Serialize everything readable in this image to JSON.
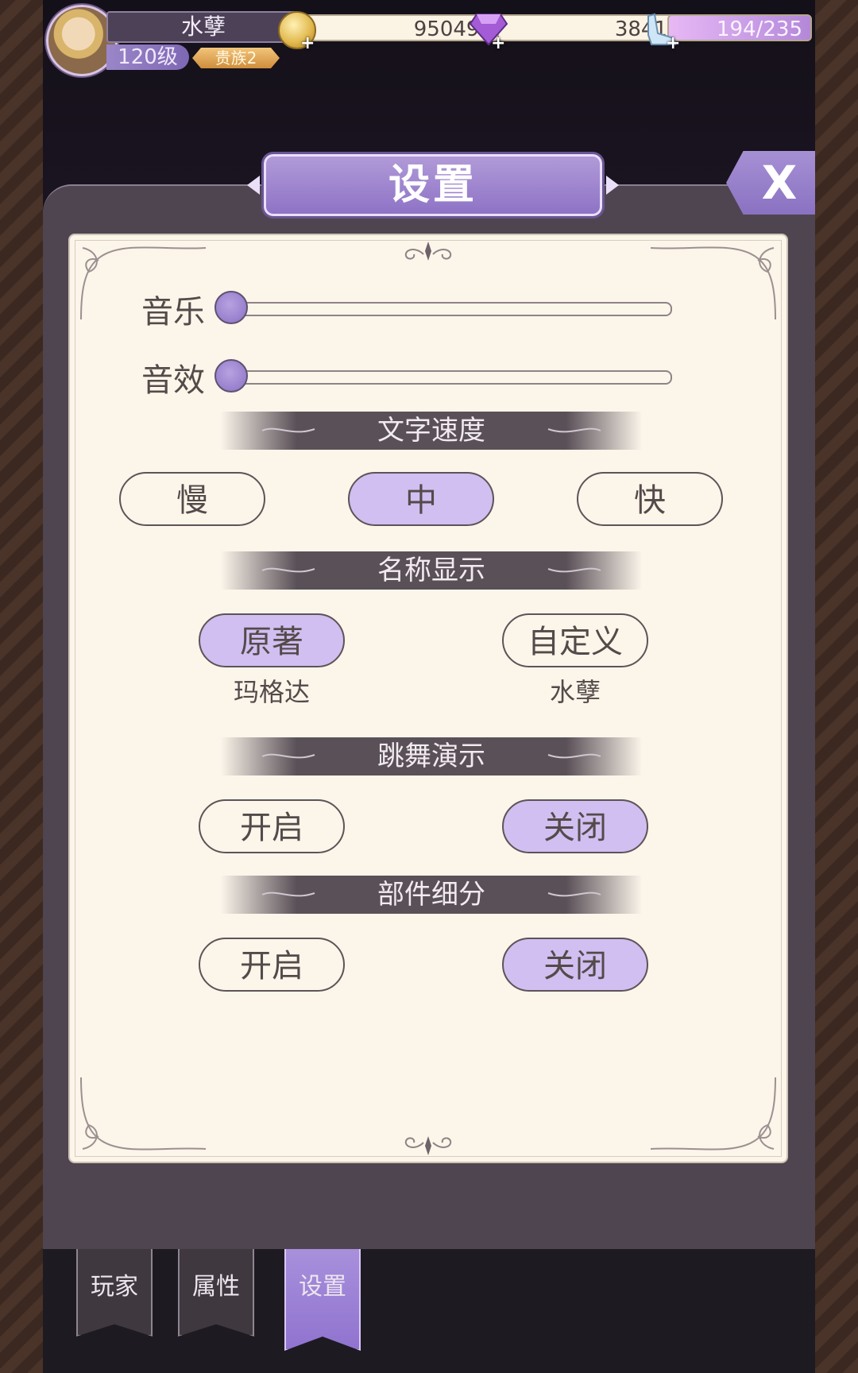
{
  "player": {
    "name": "水孽",
    "level": "120级",
    "noble": "贵族2"
  },
  "resources": {
    "gold": "950493",
    "diamonds": "3841",
    "energy": "194/235"
  },
  "title": "设置",
  "close_label": "X",
  "audio": {
    "music_label": "音乐",
    "music_level": 0,
    "sfx_label": "音效",
    "sfx_level": 0
  },
  "text_speed": {
    "header": "文字速度",
    "options": [
      "慢",
      "中",
      "快"
    ],
    "selected": "中"
  },
  "name_display": {
    "header": "名称显示",
    "options": [
      {
        "label": "原著",
        "sub": "玛格达"
      },
      {
        "label": "自定义",
        "sub": "水孽"
      }
    ],
    "selected": "原著"
  },
  "dance_demo": {
    "header": "跳舞演示",
    "on_label": "开启",
    "off_label": "关闭",
    "selected": "关闭"
  },
  "part_detail": {
    "header": "部件细分",
    "on_label": "开启",
    "off_label": "关闭",
    "selected": "关闭"
  },
  "tabs": [
    "玩家",
    "属性",
    "设置"
  ],
  "active_tab": "设置",
  "colors": {
    "accent": "#8e73c6",
    "selected_fill": "#d0bff0",
    "panel_bg": "#fbf5ea"
  }
}
